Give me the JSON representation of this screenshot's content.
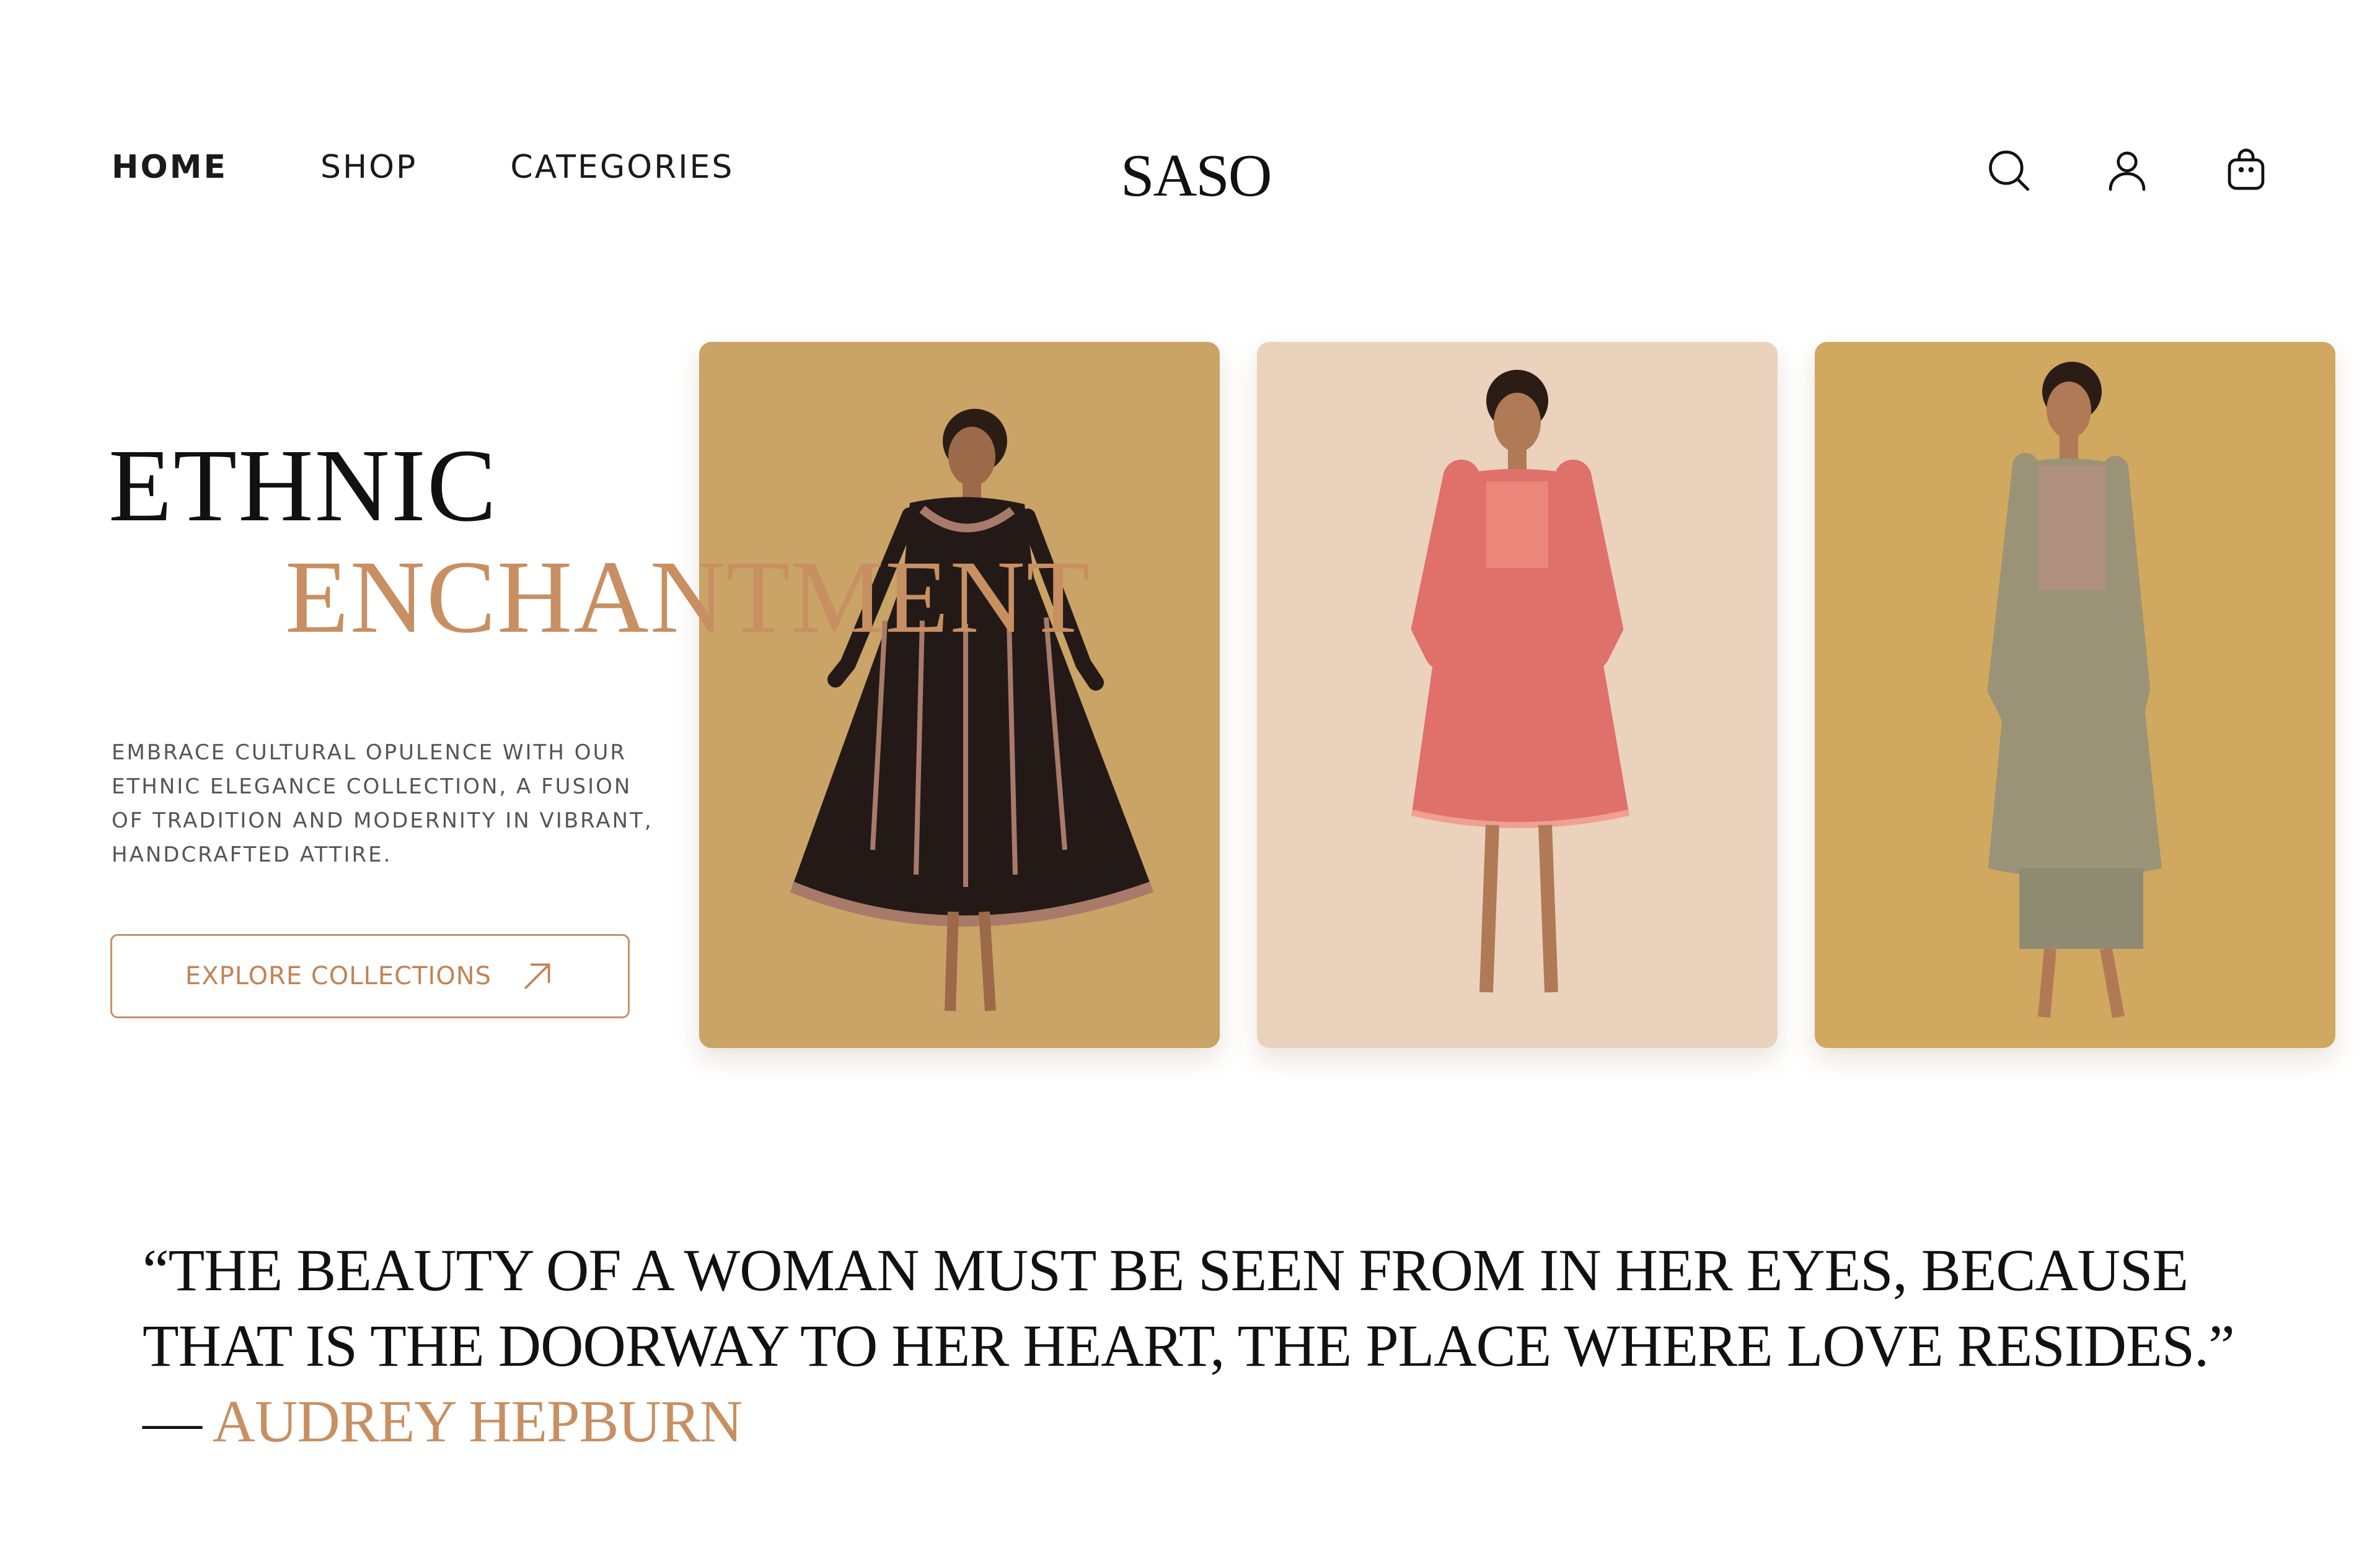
{
  "nav": {
    "items": [
      {
        "label": "HOME",
        "active": true
      },
      {
        "label": "SHOP",
        "active": false
      },
      {
        "label": "CATEGORIES",
        "active": false
      }
    ]
  },
  "brand": {
    "logo": "SASO"
  },
  "header_icons": [
    "search-icon",
    "user-icon",
    "shopping-bag-icon"
  ],
  "hero": {
    "title_line1": "ETHNIC",
    "title_line2": "ENCHANTMENT",
    "description": "EMBRACE CULTURAL OPULENCE WITH OUR ETHNIC ELEGANCE COLLECTION, A FUSION OF TRADITION AND MODERNITY IN VIBRANT, HANDCRAFTED ATTIRE.",
    "cta_label": "EXPLORE COLLECTIONS",
    "cta_icon": "arrow-up-right-icon"
  },
  "gallery": [
    {
      "name": "black anarkali dress",
      "background": "#cfa86c",
      "garment": "#231a17"
    },
    {
      "name": "pink printed kurta dress",
      "background": "#ead2bd",
      "garment": "#e0706a"
    },
    {
      "name": "sage printed kurta set",
      "background": "#d6ac63",
      "garment": "#9b9377"
    }
  ],
  "quote": {
    "text": "“THE BEAUTY OF A WOMAN MUST BE SEEN FROM IN HER EYES, BECAUSE THAT IS THE DOORWAY TO HER HEART, THE PLACE WHERE LOVE RESIDES.” — ",
    "author": "AUDREY HEPBURN"
  },
  "colors": {
    "accent": "#c88f62",
    "text": "#111111",
    "muted": "#555555",
    "background": "#ffffff"
  }
}
